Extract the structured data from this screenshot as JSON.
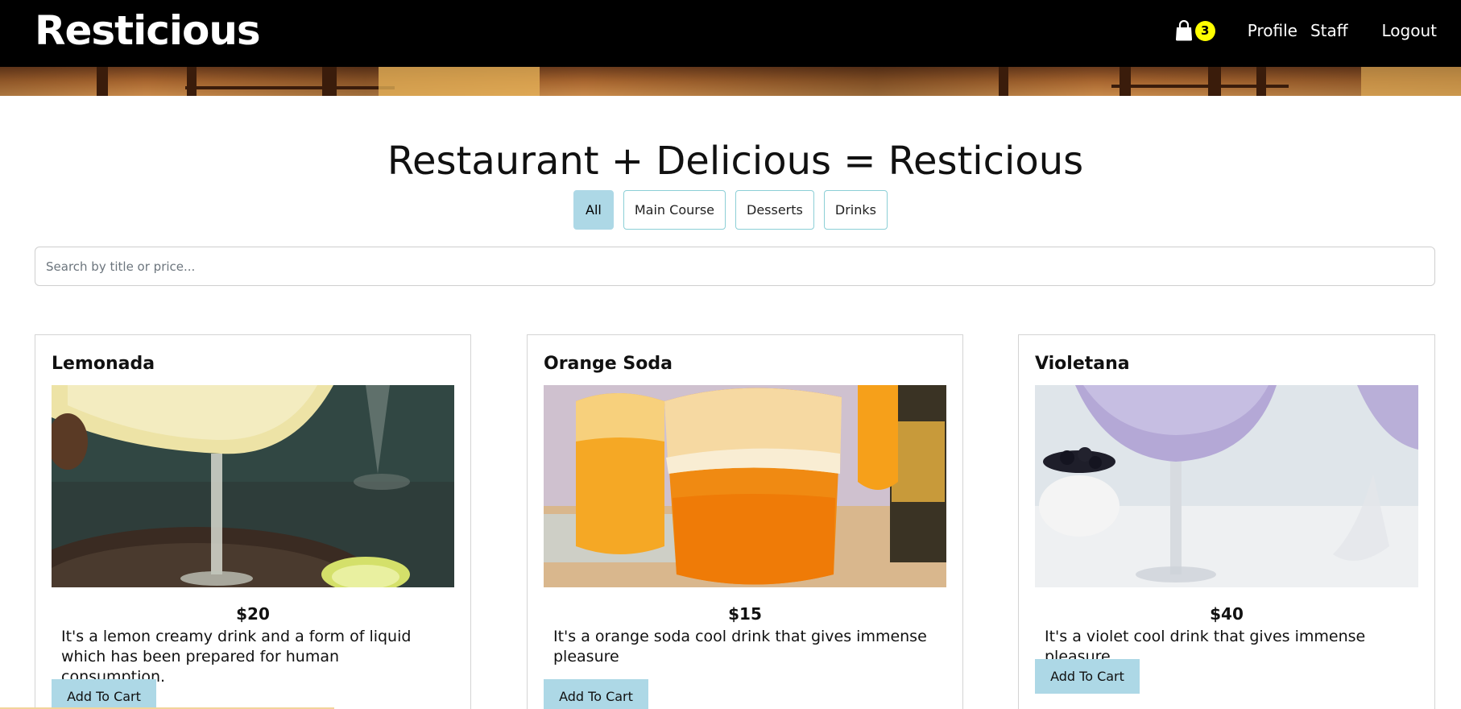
{
  "header": {
    "brand": "Resticious",
    "cart_count": "3",
    "nav": {
      "profile": "Profile",
      "staff": "Staff",
      "logout": "Logout"
    }
  },
  "main": {
    "title": "Restaurant + Delicious = Resticious",
    "filters": [
      {
        "label": "All",
        "active": true
      },
      {
        "label": "Main Course",
        "active": false
      },
      {
        "label": "Desserts",
        "active": false
      },
      {
        "label": "Drinks",
        "active": false
      }
    ],
    "search": {
      "placeholder": "Search by title or price...",
      "value": ""
    }
  },
  "products": [
    {
      "title": "Lemonada",
      "price": "$20",
      "description": "It's a lemon creamy drink and a form of liquid which has been prepared for human consumption.",
      "button": "Add To Cart",
      "image_icon": "lemon-cocktail-photo"
    },
    {
      "title": "Orange Soda",
      "price": "$15",
      "description": "It's a orange soda cool drink that gives immense pleasure",
      "button": "Add To Cart",
      "image_icon": "orange-soda-photo"
    },
    {
      "title": "Violetana",
      "price": "$40",
      "description": "It's a violet cool drink that gives immense pleasure",
      "button": "Add To Cart",
      "image_icon": "violet-cocktail-photo"
    }
  ],
  "colors": {
    "navbar": "#000000",
    "cart_badge": "#ffff00",
    "filter_active": "#add8e6",
    "filter_border": "#8ccfd6",
    "add_to_cart": "#add8e6"
  }
}
